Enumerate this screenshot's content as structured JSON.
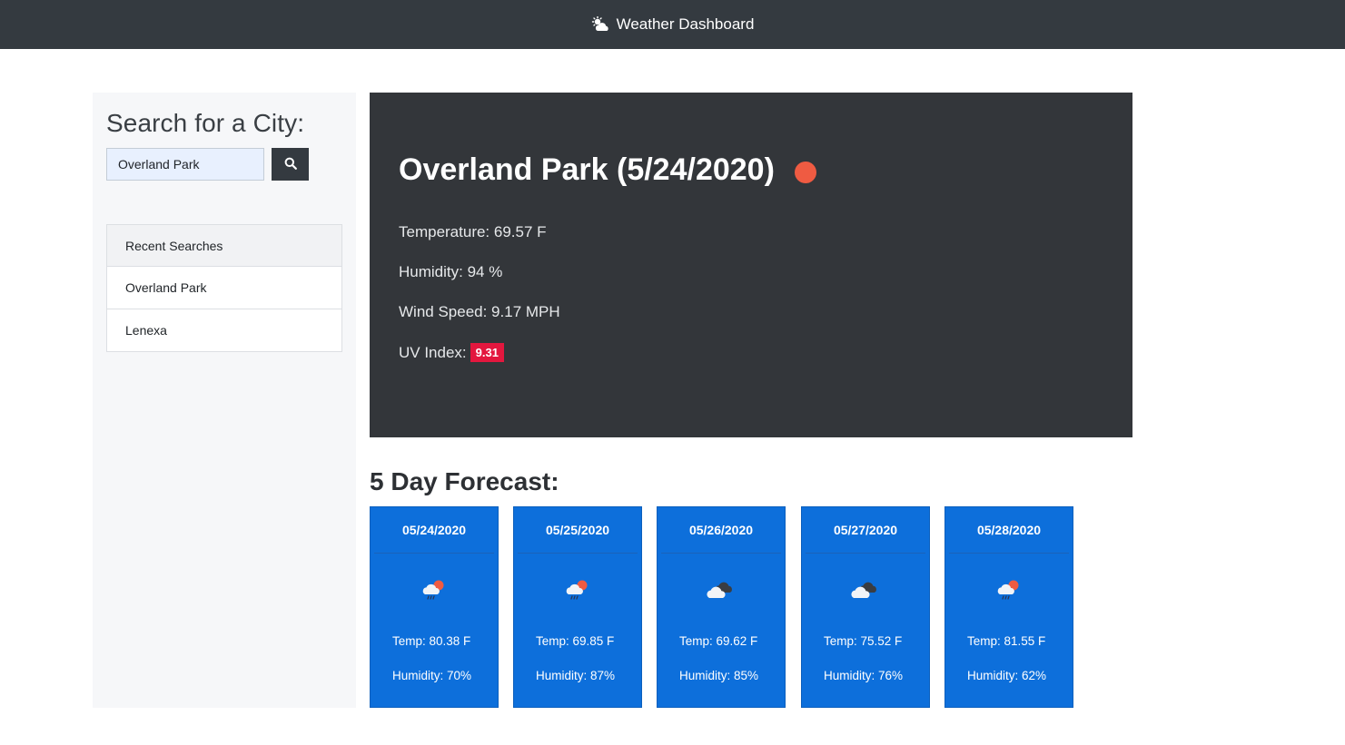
{
  "navbar": {
    "title": "Weather Dashboard",
    "icon": "cloud-sun-icon"
  },
  "sidebar": {
    "search_title": "Search for a City:",
    "search_value": "Overland Park",
    "search_icon": "search-icon",
    "recent_header": "Recent Searches",
    "recent": [
      "Overland Park",
      "Lenexa"
    ]
  },
  "current": {
    "title": "Overland Park (5/24/2020)",
    "icon": "weather-dot-icon",
    "temperature": "Temperature: 69.57 F",
    "humidity": "Humidity: 94 %",
    "wind": "Wind Speed: 9.17 MPH",
    "uv_label": "UV Index:",
    "uv_value": "9.31"
  },
  "forecast": {
    "title": "5 Day Forecast:",
    "days": [
      {
        "date": "05/24/2020",
        "icon": "rain-sun-icon",
        "temp": "Temp: 80.38 F",
        "humidity": "Humidity: 70%"
      },
      {
        "date": "05/25/2020",
        "icon": "rain-sun-icon",
        "temp": "Temp: 69.85 F",
        "humidity": "Humidity: 87%"
      },
      {
        "date": "05/26/2020",
        "icon": "cloudy-icon",
        "temp": "Temp: 69.62 F",
        "humidity": "Humidity: 85%"
      },
      {
        "date": "05/27/2020",
        "icon": "cloudy-icon",
        "temp": "Temp: 75.52 F",
        "humidity": "Humidity: 76%"
      },
      {
        "date": "05/28/2020",
        "icon": "rain-sun-icon",
        "temp": "Temp: 81.55 F",
        "humidity": "Humidity: 62%"
      }
    ]
  },
  "colors": {
    "navbar": "#343a40",
    "current_panel": "#33363a",
    "card": "#0d6fdb",
    "uv_badge": "#e3173e",
    "weather_dot": "#ef5b42"
  }
}
